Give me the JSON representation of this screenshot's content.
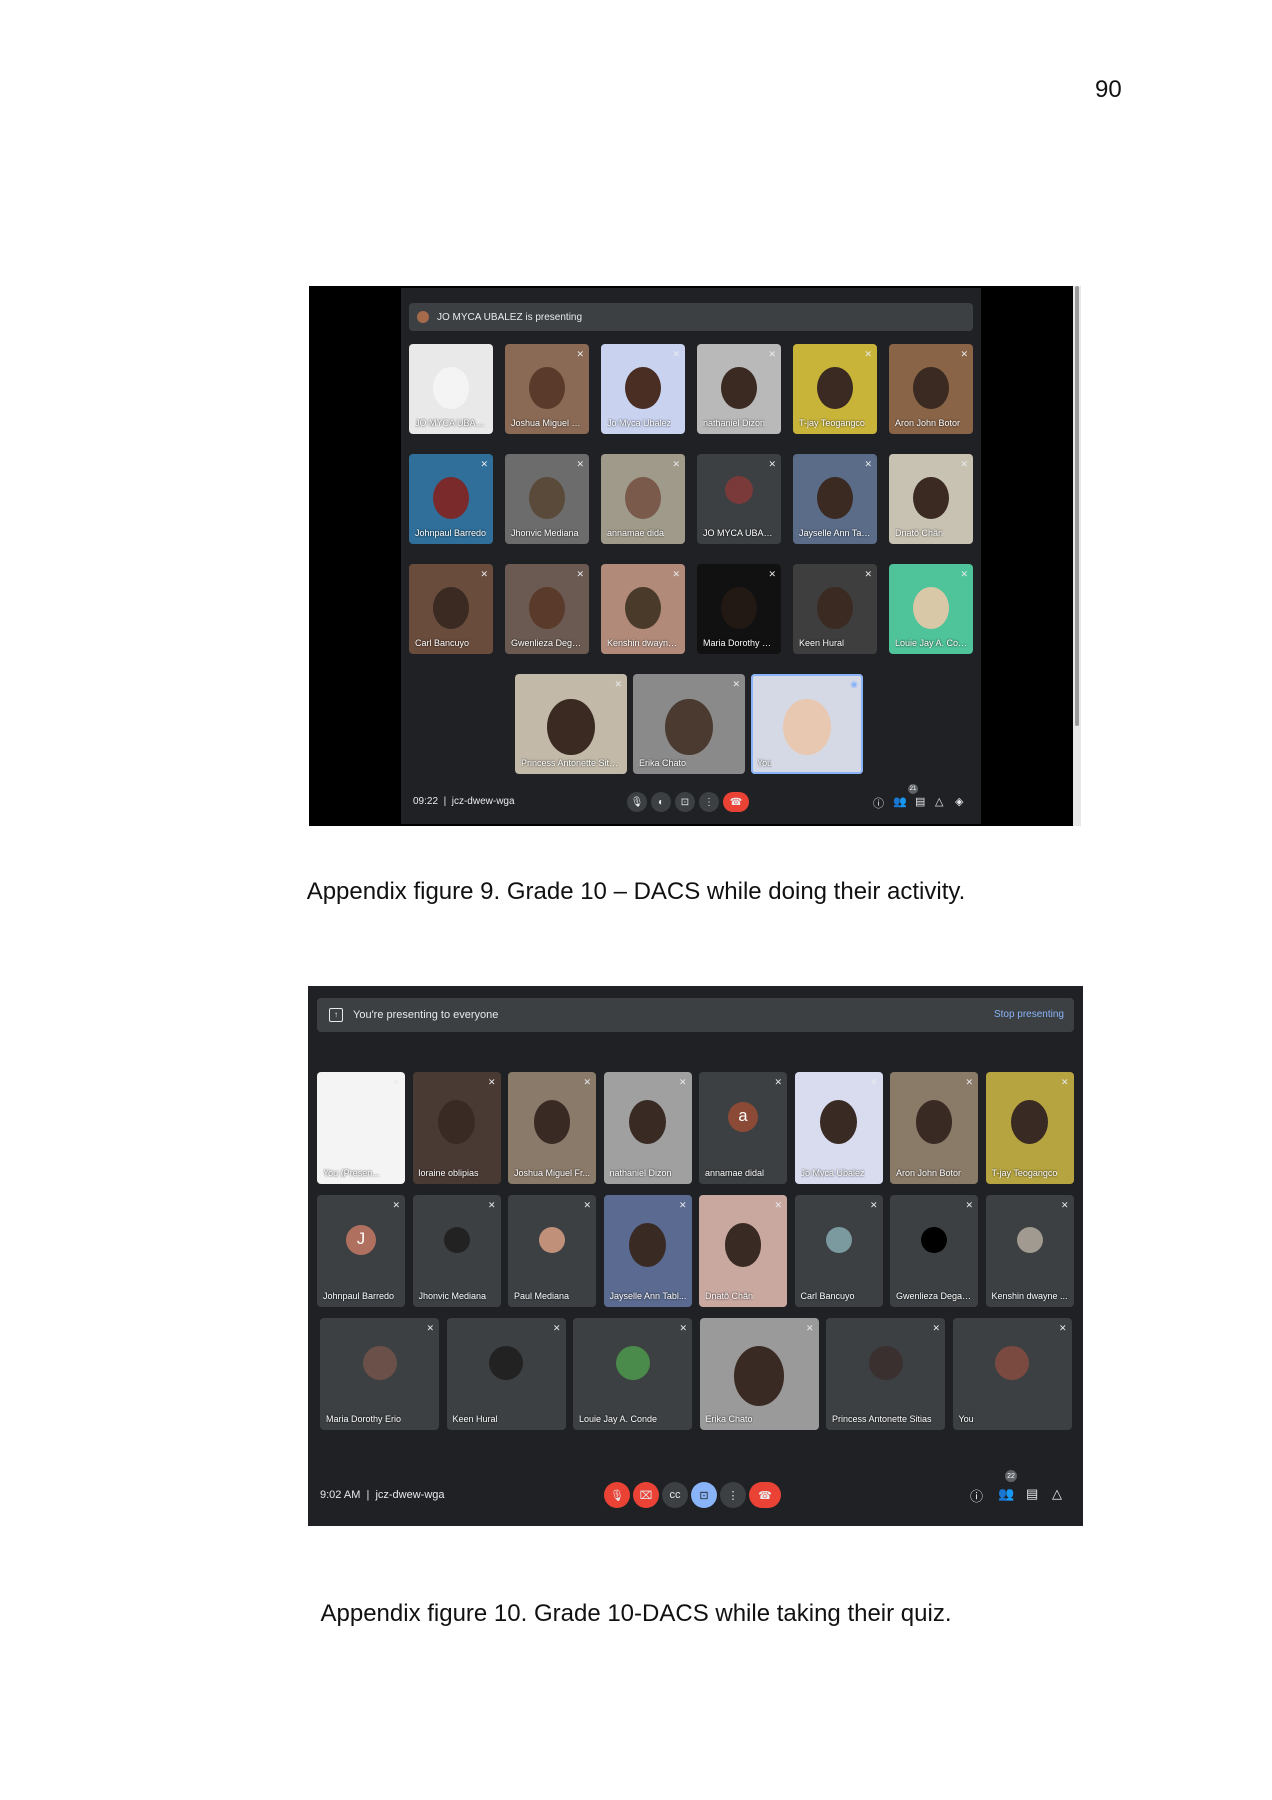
{
  "page_number": "90",
  "figure1": {
    "caption": "Appendix figure 9. Grade 10 – DACS while doing their activity.",
    "presenting_banner": "JO MYCA UBALEZ is presenting",
    "tiles": [
      {
        "name": "JO MYCA UBALEZ..."
      },
      {
        "name": "Joshua Miguel Francisco"
      },
      {
        "name": "Jo Myca Ubalez"
      },
      {
        "name": "nathaniel Dizon"
      },
      {
        "name": "T-jay Teogangco"
      },
      {
        "name": "Aron John Botor"
      },
      {
        "name": "Johnpaul Barredo"
      },
      {
        "name": "Jhonvic Mediana"
      },
      {
        "name": "annamae dida"
      },
      {
        "name": "JO MYCA UBALEZ"
      },
      {
        "name": "Jayselle Ann Tablada"
      },
      {
        "name": "Dnatõ Chãn"
      },
      {
        "name": "Carl Bancuyo"
      },
      {
        "name": "Gwenlieza Degamo"
      },
      {
        "name": "Kenshin dwayne Isuari..."
      },
      {
        "name": "Maria Dorothy Erio"
      },
      {
        "name": "Keen Hural"
      },
      {
        "name": "Louie Jay A. Conde"
      },
      {
        "name": "Princess Antonette Sitias"
      },
      {
        "name": "Erika Chato"
      },
      {
        "name": "You"
      }
    ],
    "time": "09:22",
    "meeting_code": "jcz-dwew-wga",
    "participant_count": "21"
  },
  "figure2": {
    "caption": "Appendix figure 10. Grade 10-DACS while taking their quiz.",
    "presenting_banner": "You're presenting to everyone",
    "stop_presenting": "Stop presenting",
    "tiles": [
      {
        "name": "You (Presen..."
      },
      {
        "name": "loraine oblipias"
      },
      {
        "name": "Joshua Miguel Fr..."
      },
      {
        "name": "nathaniel Dizon"
      },
      {
        "name": "annamae didal",
        "initial": "a"
      },
      {
        "name": "Jo Myca Ubalez"
      },
      {
        "name": "Aron John Botor"
      },
      {
        "name": "T-jay Teogangco"
      },
      {
        "name": "Johnpaul Barredo",
        "initial": "J"
      },
      {
        "name": "Jhonvic Mediana"
      },
      {
        "name": "Paul Mediana"
      },
      {
        "name": "Jayselle Ann Tabl..."
      },
      {
        "name": "Dnatõ Chãn"
      },
      {
        "name": "Carl Bancuyo"
      },
      {
        "name": "Gwenlieza Degamo"
      },
      {
        "name": "Kenshin dwayne ..."
      },
      {
        "name": "Maria Dorothy Erio"
      },
      {
        "name": "Keen Hural"
      },
      {
        "name": "Louie Jay A. Conde"
      },
      {
        "name": "Erika Chato"
      },
      {
        "name": "Princess Antonette Sitias"
      },
      {
        "name": "You"
      }
    ],
    "time": "9:02 AM",
    "meeting_code": "jcz-dwew-wga",
    "participant_count": "22"
  }
}
